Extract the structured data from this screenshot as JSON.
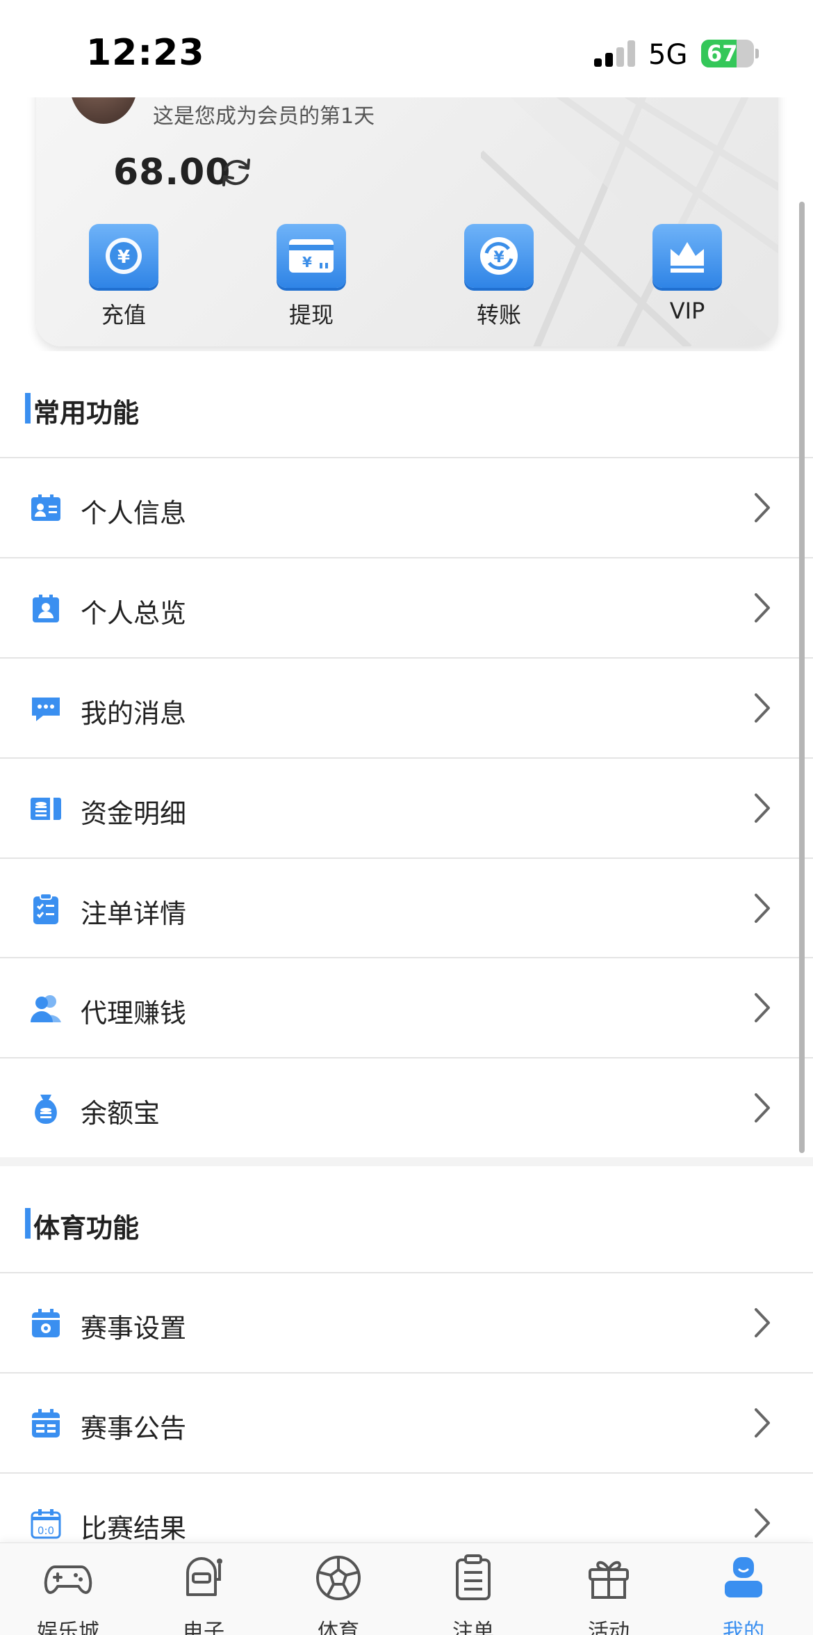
{
  "status_bar": {
    "time": "12:23",
    "network": "5G",
    "battery": "67",
    "battery_level": 0.67
  },
  "member": {
    "days_text": "这是您成为会员的第1天",
    "balance": "68.00"
  },
  "quick_actions": [
    {
      "label": "充值",
      "icon": "yuan-coin-icon"
    },
    {
      "label": "提现",
      "icon": "withdraw-card-icon"
    },
    {
      "label": "转账",
      "icon": "transfer-icon"
    },
    {
      "label": "VIP",
      "icon": "crown-icon"
    }
  ],
  "common_section": {
    "title": "常用功能",
    "items": [
      {
        "label": "个人信息",
        "icon": "id-card-icon"
      },
      {
        "label": "个人总览",
        "icon": "profile-overview-icon"
      },
      {
        "label": "我的消息",
        "icon": "message-icon"
      },
      {
        "label": "资金明细",
        "icon": "ledger-icon"
      },
      {
        "label": "注单详情",
        "icon": "checklist-icon"
      },
      {
        "label": "代理赚钱",
        "icon": "agents-icon"
      },
      {
        "label": "余额宝",
        "icon": "money-bag-icon"
      }
    ]
  },
  "sports_section": {
    "title": "体育功能",
    "items": [
      {
        "label": "赛事设置",
        "icon": "event-settings-icon"
      },
      {
        "label": "赛事公告",
        "icon": "announcement-icon"
      },
      {
        "label": "比赛结果",
        "icon": "scoreboard-icon"
      }
    ]
  },
  "tabs": [
    {
      "label": "娱乐城",
      "icon": "gamepad-icon",
      "active": false
    },
    {
      "label": "电子",
      "icon": "slot-machine-icon",
      "active": false
    },
    {
      "label": "体育",
      "icon": "soccer-ball-icon",
      "active": false
    },
    {
      "label": "注单",
      "icon": "clipboard-icon",
      "active": false
    },
    {
      "label": "活动",
      "icon": "gift-icon",
      "active": false
    },
    {
      "label": "我的",
      "icon": "user-icon",
      "active": true
    }
  ],
  "colors": {
    "accent": "#3a8ff0",
    "battery": "#34c759"
  }
}
